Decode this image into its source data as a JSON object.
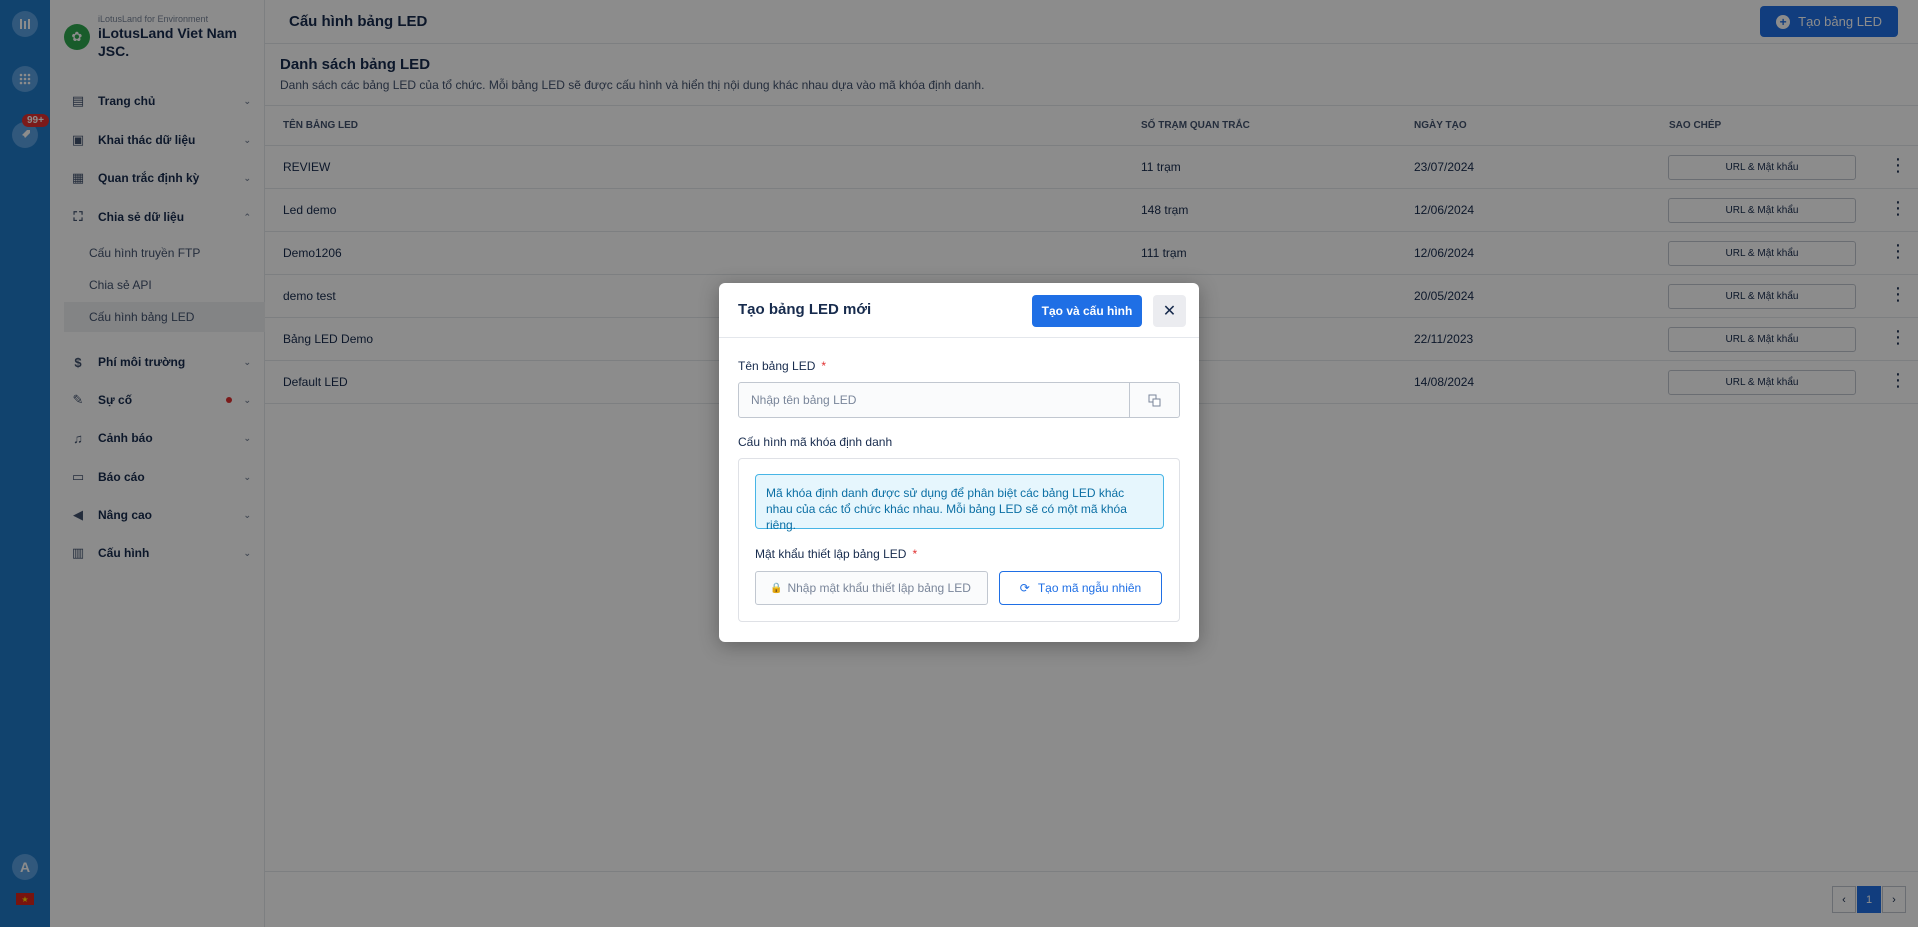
{
  "rail": {
    "badge": "99+",
    "avatar_letter": "A",
    "flag_symbol": "★"
  },
  "org": {
    "subtitle": "iLotusLand for Environment",
    "name": "iLotusLand Viet Nam JSC."
  },
  "sidebar": {
    "items": [
      {
        "label": "Trang chủ",
        "icon": "layout-icon"
      },
      {
        "label": "Khai thác dữ liệu",
        "icon": "monitor-chart-icon"
      },
      {
        "label": "Quan trắc định kỳ",
        "icon": "document-icon"
      },
      {
        "label": "Chia sẻ dữ liệu",
        "icon": "share-icon"
      },
      {
        "label": "Phí môi trường",
        "icon": "dollar-icon"
      },
      {
        "label": "Sự cố",
        "icon": "edit-icon"
      },
      {
        "label": "Cảnh báo",
        "icon": "bell-icon"
      },
      {
        "label": "Báo cáo",
        "icon": "report-icon"
      },
      {
        "label": "Nâng cao",
        "icon": "megaphone-icon"
      },
      {
        "label": "Cấu hình",
        "icon": "settings-icon"
      }
    ],
    "sub_items": [
      {
        "label": "Cấu hình truyền FTP"
      },
      {
        "label": "Chia sẻ API"
      },
      {
        "label": "Cấu hình bảng LED"
      }
    ]
  },
  "header": {
    "title": "Cấu hình bảng LED",
    "create_button": "Tạo bảng LED"
  },
  "section": {
    "title": "Danh sách bảng LED",
    "description": "Danh sách các bảng LED của tổ chức. Mỗi bảng LED sẽ được cấu hình và hiển thị nội dung khác nhau dựa vào mã khóa định danh."
  },
  "table": {
    "columns": [
      "TÊN BẢNG LED",
      "SỐ TRẠM QUAN TRẮC",
      "NGÀY TẠO",
      "SAO CHÉP"
    ],
    "rows": [
      {
        "name": "REVIEW",
        "stations": "11 trạm",
        "date": "23/07/2024",
        "copy": "URL & Mật khẩu"
      },
      {
        "name": "Led demo",
        "stations": "148 trạm",
        "date": "12/06/2024",
        "copy": "URL & Mật khẩu"
      },
      {
        "name": "Demo1206",
        "stations": "111 trạm",
        "date": "12/06/2024",
        "copy": "URL & Mật khẩu"
      },
      {
        "name": "demo test",
        "stations": "",
        "date": "20/05/2024",
        "copy": "URL & Mật khẩu"
      },
      {
        "name": "Bảng LED Demo",
        "stations": "",
        "date": "22/11/2023",
        "copy": "URL & Mật khẩu"
      },
      {
        "name": "Default LED",
        "stations": "",
        "date": "14/08/2024",
        "copy": "URL & Mật khẩu"
      }
    ]
  },
  "pagination": {
    "prev": "‹",
    "current": "1",
    "next": "›"
  },
  "modal": {
    "title": "Tạo bảng LED mới",
    "submit_button": "Tạo và cấu hình",
    "close": "✕",
    "name_label": "Tên bảng LED",
    "name_placeholder": "Nhập tên bảng LED",
    "config_label": "Cấu hình mã khóa định danh",
    "info_text": "Mã khóa định danh được sử dụng để phân biệt các bảng LED khác nhau của các tổ chức khác nhau. Mỗi bảng LED sẽ có một mã khóa riêng.",
    "password_label": "Mật khẩu thiết lập bảng LED",
    "password_placeholder": "Nhập mật khẩu thiết lập bảng LED",
    "generate_button": "Tạo mã ngẫu nhiên",
    "required_mark": "*"
  },
  "colors": {
    "rail": "#1f7ac8",
    "primary": "#1f6fe5",
    "danger": "#e03131",
    "info_bg": "#e6f6fd",
    "info_border": "#47b5e6"
  }
}
